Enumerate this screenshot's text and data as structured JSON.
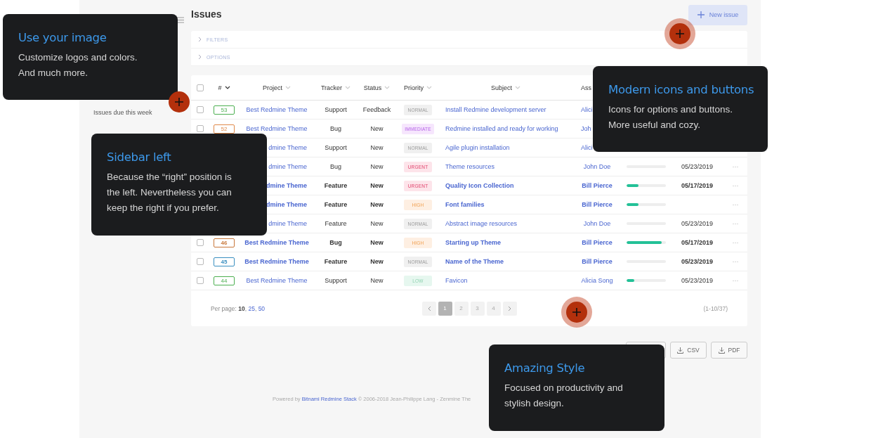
{
  "sidebar": {
    "items": [
      {
        "label": "Issues due this week"
      }
    ]
  },
  "header": {
    "title": "Issues",
    "new_button": "New issue"
  },
  "panels": [
    {
      "label": "FILTERS",
      "expanded": false
    },
    {
      "label": "OPTIONS",
      "expanded": false
    }
  ],
  "table": {
    "select_all": {
      "checked": false
    },
    "columns": [
      {
        "label": "#",
        "sorted": true
      },
      {
        "label": "Project",
        "sorted": false
      },
      {
        "label": "Tracker",
        "sorted": false
      },
      {
        "label": "Status",
        "sorted": false
      },
      {
        "label": "Priority",
        "sorted": false
      },
      {
        "label": "Subject",
        "sorted": false
      },
      {
        "label": "Ass"
      }
    ],
    "rows": [
      {
        "checked": false,
        "id": "53",
        "color": "#4caf50",
        "project": "Best Redmine Theme",
        "tracker": "Support",
        "status": "Feedback",
        "priority": {
          "label": "NORMAL",
          "kind": "normal"
        },
        "subject": "Install Redmine development server",
        "assignee": "Alici",
        "unread": false
      },
      {
        "checked": false,
        "id": "52",
        "color": "#e08a4a",
        "project": "Best Redmine Theme",
        "tracker": "Bug",
        "status": "New",
        "priority": {
          "label": "IMMEDIATE",
          "kind": "immediate"
        },
        "subject": "Redmine installed and ready for working",
        "assignee": "Joh",
        "unread": false
      },
      {
        "project": "dmine Theme",
        "tracker": "Support",
        "status": "New",
        "priority": {
          "label": "NORMAL",
          "kind": "normal"
        },
        "subject": "Agile plugin installation",
        "assignee": "Alici",
        "unread": false
      },
      {
        "project": "dmine Theme",
        "tracker": "Bug",
        "status": "New",
        "priority": {
          "label": "URGENT",
          "kind": "urgent"
        },
        "subject": "Theme resources",
        "assignee": "John Doe",
        "level": 0,
        "due": "05/23/2019",
        "more": "···",
        "unread": false
      },
      {
        "project": "dmine Theme",
        "tracker": "Feature",
        "status": "New",
        "priority": {
          "label": "URGENT",
          "kind": "urgent"
        },
        "subject": "Quality Icon Collection",
        "assignee": "Bill Pierce",
        "level": 0.3,
        "due": "05/17/2019",
        "more": "···",
        "unread": true
      },
      {
        "project": "dmine Theme",
        "tracker": "Feature",
        "status": "New",
        "priority": {
          "label": "HIGH",
          "kind": "high"
        },
        "subject": "Font families",
        "assignee": "Bill Pierce",
        "level": 0.3,
        "more": "···",
        "unread": true
      },
      {
        "project": "dmine Theme",
        "tracker": "Feature",
        "status": "New",
        "priority": {
          "label": "NORMAL",
          "kind": "normal"
        },
        "subject": "Abstract image resources",
        "assignee": "John Doe",
        "level": 0,
        "due": "05/23/2019",
        "more": "···",
        "unread": false
      },
      {
        "checked": false,
        "id": "46",
        "color": "#c8773a",
        "project": "Best Redmine Theme",
        "tracker": "Bug",
        "status": "New",
        "priority": {
          "label": "HIGH",
          "kind": "high"
        },
        "subject": "Starting up Theme",
        "assignee": "Bill Pierce",
        "level": 0.9,
        "due": "05/17/2019",
        "more": "···",
        "unread": true
      },
      {
        "checked": false,
        "id": "45",
        "color": "#3a8fc0",
        "project": "Best Redmine Theme",
        "tracker": "Feature",
        "status": "New",
        "priority": {
          "label": "NORMAL",
          "kind": "normal"
        },
        "subject": "Name of the Theme",
        "assignee": "Bill Pierce",
        "level": 0,
        "due": "05/23/2019",
        "more": "···",
        "unread": true
      },
      {
        "checked": false,
        "id": "44",
        "color": "#4caf50",
        "project": "Best Redmine Theme",
        "tracker": "Support",
        "status": "New",
        "priority": {
          "label": "LOW",
          "kind": "low"
        },
        "subject": "Favicon",
        "assignee": "Alicia Song",
        "level": 0.2,
        "due": "05/23/2019",
        "more": "···",
        "unread": false
      }
    ],
    "per_page": {
      "label": "Per page:",
      "separator": ", ",
      "options": [
        {
          "text": "10",
          "selected": true
        },
        {
          "text": "25",
          "selected": false
        },
        {
          "text": "50",
          "selected": false
        }
      ]
    },
    "pages": [
      {
        "label": "1",
        "selected": true
      },
      {
        "label": "2",
        "selected": false
      },
      {
        "label": "3",
        "selected": false
      },
      {
        "label": "4",
        "selected": false
      }
    ],
    "count": "(1-10/37)"
  },
  "exports": [
    {
      "kind": "covered"
    },
    {
      "kind": "download",
      "label": "CSV"
    },
    {
      "kind": "download",
      "label": "PDF"
    }
  ],
  "footer": {
    "prefix": "Powered by",
    "link": "Bitnami Redmine Stack",
    "suffix": "© 2006-2018 Jean-Philippe Lang - Zenmine The"
  },
  "callouts": [
    {
      "title": "Use your image",
      "body": "Customize logos and colors.\nAnd much more."
    },
    {
      "title": "Sidebar left",
      "body": "Because the “right” position is\nthe left. Nevertheless you can\nkeep the right if you prefer."
    },
    {
      "title": "Modern icons and buttons",
      "body": "Icons for options and buttons.\nMore useful and cozy."
    },
    {
      "title": "Amazing Style",
      "body": "Focused on productivity and\nstylish design."
    }
  ],
  "hotspots": [
    {
      "halo": false
    },
    {
      "halo": true
    },
    {
      "halo": true
    }
  ]
}
